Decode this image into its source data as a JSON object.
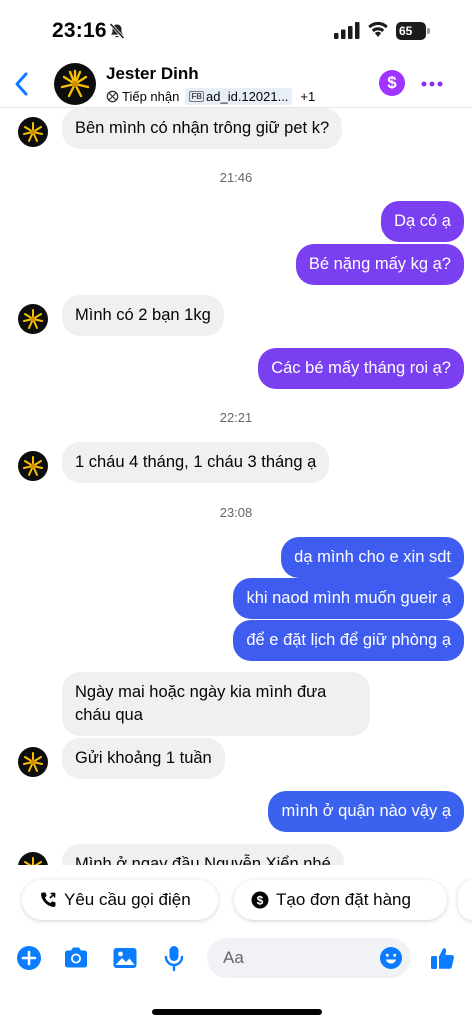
{
  "status_bar": {
    "time": "23:16",
    "battery": "65",
    "battery_level": 0.65
  },
  "header": {
    "contact_name": "Jester Dinh",
    "status_label": "Tiếp nhận",
    "ad_badge_prefix": "FB",
    "ad_label": "ad_id.12021...",
    "extra_count": "+1",
    "dollar_symbol": "$",
    "icons": [
      "back-arrow-icon",
      "contact-avatar",
      "receive-icon",
      "dollar-icon",
      "more-icon"
    ]
  },
  "messages": [
    {
      "side": "in",
      "text": "Bên mình có nhận trông giữ pet k?"
    },
    {
      "type": "time",
      "text": "21:46"
    },
    {
      "side": "out",
      "text": "Dạ có ạ"
    },
    {
      "side": "out",
      "text": "Bé nặng mấy kg ạ?"
    },
    {
      "side": "in",
      "text": "Mình có 2 bạn 1kg"
    },
    {
      "side": "out",
      "text": "Các bé mấy tháng roi ạ?"
    },
    {
      "type": "time",
      "text": "22:21"
    },
    {
      "side": "in",
      "text": "1 cháu 4 tháng, 1 cháu 3 tháng  ạ"
    },
    {
      "type": "time",
      "text": "23:08"
    },
    {
      "side": "out",
      "text": "dạ mình cho e xin sdt"
    },
    {
      "side": "out",
      "text": "khi naod mình muốn gueir ạ"
    },
    {
      "side": "out",
      "text": "để e đặt lịch để giữ phòng ạ"
    },
    {
      "side": "in",
      "text": "Ngày mai hoặc ngày kia mình đưa cháu qua"
    },
    {
      "side": "in",
      "text": "Gửi khoảng 1 tuần"
    },
    {
      "side": "out",
      "text": "mình ở quận nào vậy ạ"
    },
    {
      "side": "in",
      "text": "Mình ở ngay đầu Nguyễn Xiển nhé"
    }
  ],
  "quick_replies": [
    {
      "label": "Yêu cầu gọi điện",
      "icon": "phone-icon"
    },
    {
      "label": "Tạo đơn đặt hàng",
      "icon": "dollar-circle-icon"
    }
  ],
  "composer": {
    "placeholder": "Aa",
    "icons": [
      "plus-icon",
      "camera-icon",
      "image-icon",
      "microphone-icon",
      "emoji-icon",
      "like-icon"
    ]
  },
  "colors": {
    "outgoing_purple": "#7a3ff0",
    "outgoing_blue": "#3f5cf0",
    "incoming": "#f0f0f0",
    "accent": "#0a7cff",
    "dollar": "#a033ff"
  }
}
